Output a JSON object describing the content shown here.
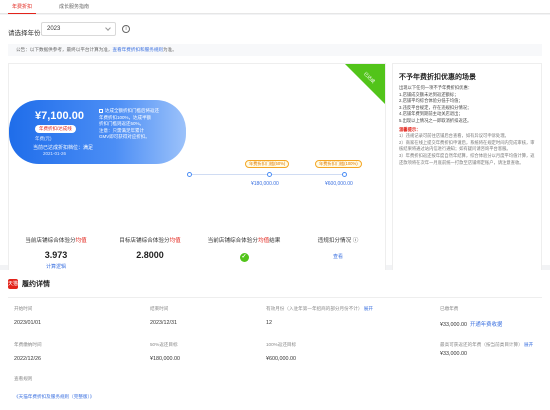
{
  "tabs": [
    {
      "label": "年费折扣"
    },
    {
      "label": "成长服务指南"
    }
  ],
  "filter": {
    "label": "请选择年份:",
    "year": "2023",
    "info": "i"
  },
  "notice": {
    "text": "公告：以下数据供参考，最终以平台计算为准，",
    "link": "查看年费折扣和服务规则",
    "suffix": "为准。"
  },
  "card": {
    "amount": "¥7,100.00",
    "chip": "年费折扣/达成线",
    "line1": "年费(元)",
    "line2": "当前已达成折扣档位：满足",
    "line3": "2021-01-26",
    "desc": [
      "达成全额折扣门槛后将返还",
      "年费折扣100%，达成半额",
      "折扣门槛则返还50%。",
      "注意：只需满足年累计",
      "GMV即可获得对应折扣。"
    ]
  },
  "ribbon": "已达成",
  "tiers": [
    {
      "badge": "年费折扣门槛(50%)",
      "amount": "¥180,000.00"
    },
    {
      "badge": "年费折扣门槛(100%)",
      "amount": "¥600,000.00"
    }
  ],
  "metrics": [
    {
      "title": "当前店铺综合体验分",
      "title_hl": "均值",
      "value": "3.973",
      "link": "计算逻辑"
    },
    {
      "title": "目标店铺综合体验分",
      "title_hl": "均值",
      "value": "2.8000",
      "link": ""
    },
    {
      "title": "当前店铺综合体验分",
      "title_hl": "均值",
      "suffix": "结果",
      "value": "✓",
      "link": ""
    },
    {
      "title": "违规扣分情况",
      "title_hl": "",
      "value": "",
      "link": "查看"
    }
  ],
  "rules": {
    "title": "不予年费折扣优惠的场景",
    "intro": "出现以下任何一项不予年费折扣优惠：",
    "items": [
      "1.店铺成交额未达到返还额标；",
      "2.店铺平均综合体验分低于均值；",
      "3.违反平台规定，存在违规扣分情况；",
      "4.店铺年费到期前主动关店退出；",
      "5.出现以上情况之一即取消折扣返还。"
    ],
    "note_title": "温馨提示：",
    "notes": [
      "1）违规记录可前往店铺后台查看，如有异议可申诉处理。",
      "2）商家在线上提交年费折扣申请后，系统将在规定时间内完成审核，审核结果将通过站内信进行通知；如有疑问请咨询平台客服。",
      "3）年费折扣返还按年度自然年结算，综合体验分以月度平均值计算，返还款项将在次年一月底前统一打款至店铺绑定账户，请注意查收。"
    ]
  },
  "detail": {
    "logo": "天猫",
    "title": "履约详情",
    "row1": [
      {
        "label": "开始时间",
        "value": "2023/01/01",
        "link": ""
      },
      {
        "label": "结束时间",
        "value": "2023/12/31",
        "link": ""
      },
      {
        "label": "有效月份（入驻年第一年招商的部分月份不计）",
        "label_link": "展开",
        "value": "12",
        "link": ""
      },
      {
        "label": "已缴年费",
        "value": "¥33,000.00",
        "link": "开通年费收据"
      }
    ],
    "row2": [
      {
        "label": "年费缴纳时间",
        "value": "2022/12/26",
        "link": ""
      },
      {
        "label": "50%返还目标",
        "value": "¥180,000.00",
        "link": ""
      },
      {
        "label": "100%返还目标",
        "value": "¥600,000.00",
        "link": ""
      },
      {
        "label": "最高可获返还的年费（按当前类目计算）",
        "label_link": "展开",
        "value": "¥33,000.00",
        "link": ""
      }
    ],
    "rule_label": "查看规则",
    "rule_link": "《天猫年费折扣及服务规则（完整版）》"
  }
}
